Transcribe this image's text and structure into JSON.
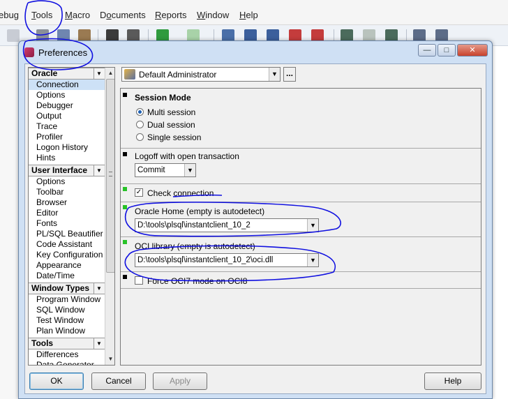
{
  "app": {
    "menu": [
      {
        "label": "ebug",
        "key": "",
        "rest": ""
      },
      {
        "label": "",
        "key": "T",
        "rest": "ools"
      },
      {
        "label": "",
        "key": "M",
        "rest": "acro"
      },
      {
        "label": "D",
        "key": "o",
        "rest": "cuments"
      },
      {
        "label": "",
        "key": "R",
        "rest": "eports"
      },
      {
        "label": "",
        "key": "W",
        "rest": "indow"
      },
      {
        "label": "",
        "key": "H",
        "rest": "elp"
      }
    ]
  },
  "dialog": {
    "title": "Preferences",
    "buttons": {
      "minimize": "—",
      "maximize": "□",
      "close": "✕"
    }
  },
  "tree": {
    "categories": [
      {
        "name": "Oracle",
        "items": [
          "Connection",
          "Options",
          "Debugger",
          "Output",
          "Trace",
          "Profiler",
          "Logon History",
          "Hints"
        ]
      },
      {
        "name": "User Interface",
        "items": [
          "Options",
          "Toolbar",
          "Browser",
          "Editor",
          "Fonts",
          "PL/SQL Beautifier",
          "Code Assistant",
          "Key Configuration",
          "Appearance",
          "Date/Time"
        ]
      },
      {
        "name": "Window Types",
        "items": [
          "Program Window",
          "SQL Window",
          "Test Window",
          "Plan Window"
        ]
      },
      {
        "name": "Tools",
        "items": [
          "Differences",
          "Data Generator"
        ]
      }
    ],
    "selected": "Connection"
  },
  "profile": {
    "value": "Default Administrator",
    "more": "..."
  },
  "settings": {
    "session_mode": {
      "title": "Session Mode",
      "options": [
        "Multi session",
        "Dual session",
        "Single session"
      ],
      "selected": "Multi session"
    },
    "logoff": {
      "label": "Logoff with open transaction",
      "value": "Commit"
    },
    "check_connection": {
      "label": "Check connection",
      "checked": true
    },
    "oracle_home": {
      "label": "Oracle Home (empty is autodetect)",
      "value": "D:\\tools\\plsql\\instantclient_10_2"
    },
    "oci_library": {
      "label": "OCI library (empty is autodetect)",
      "value": "D:\\tools\\plsql\\instantclient_10_2\\oci.dll"
    },
    "force_oci7": {
      "label": "Force OCI7 mode on OCI8",
      "checked": false
    }
  },
  "footer": {
    "ok": "OK",
    "cancel": "Cancel",
    "apply": "Apply",
    "help": "Help"
  },
  "colors": {
    "selection": "#cde1f6",
    "marker_green": "#27c227",
    "annotation": "#1010e0"
  }
}
